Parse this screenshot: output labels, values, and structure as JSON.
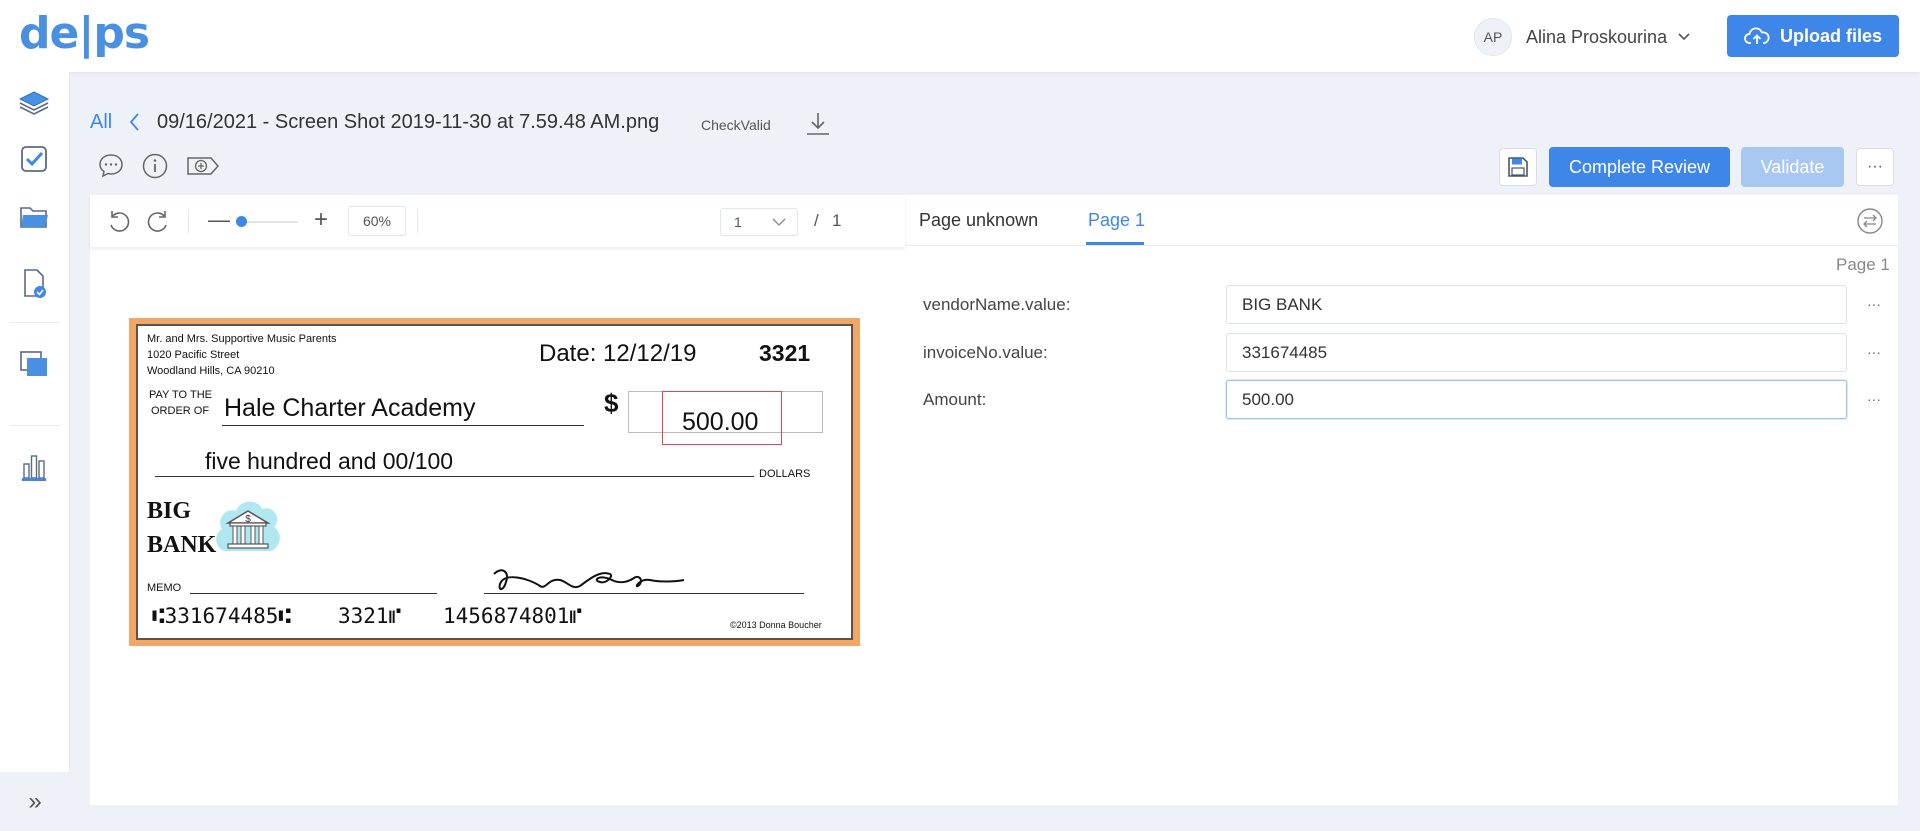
{
  "app": {
    "logo": "de|ps",
    "user_initials": "AP",
    "user_name": "Alina Proskourina",
    "upload_label": "Upload files"
  },
  "breadcrumb": {
    "all_label": "All",
    "doc_title": "09/16/2021 - Screen Shot 2019-11-30 at 7.59.48 AM.png",
    "doc_type": "CheckValid"
  },
  "actions": {
    "complete_label": "Complete Review",
    "validate_label": "Validate",
    "more_label": "···"
  },
  "viewer": {
    "zoom_value": "60%",
    "page_current": "1",
    "page_separator": "/",
    "page_total": "1"
  },
  "check": {
    "payer_line1": "Mr. and Mrs. Supportive Music Parents",
    "payer_line2": "1020 Pacific Street",
    "payer_line3": "Woodland Hills, CA 90210",
    "date_text": "Date: 12/12/19",
    "check_number": "3321",
    "pay_to_line1": "PAY TO THE",
    "pay_to_line2": "ORDER OF",
    "payee": "Hale Charter Academy",
    "dollar_sign": "$",
    "amount": "500.00",
    "amount_words": "five hundred and 00/100",
    "dollars_label": "DOLLARS",
    "bank_line1": "BIG",
    "bank_line2": "BANK",
    "memo_label": "MEMO",
    "micr_routing": "⑆331674485⑆",
    "micr_check": "3321⑈",
    "micr_account": "1456874801⑈",
    "copyright": "©2013 Donna Boucher"
  },
  "review": {
    "tabs": [
      "Page unknown",
      "Page 1"
    ],
    "active_tab": 1,
    "page_indicator": "Page 1",
    "fields": [
      {
        "label": "vendorName.value:",
        "value": "BIG BANK"
      },
      {
        "label": "invoiceNo.value:",
        "value": "331674485"
      },
      {
        "label": "Amount:",
        "value": "500.00"
      }
    ],
    "field_more": "···"
  },
  "sidebar": {
    "expand_label": "»"
  },
  "colors": {
    "accent": "#3e87e8",
    "validate_disabled": "#a8c8f2",
    "highlight": "#e0474c",
    "check_border": "#f2a766"
  }
}
